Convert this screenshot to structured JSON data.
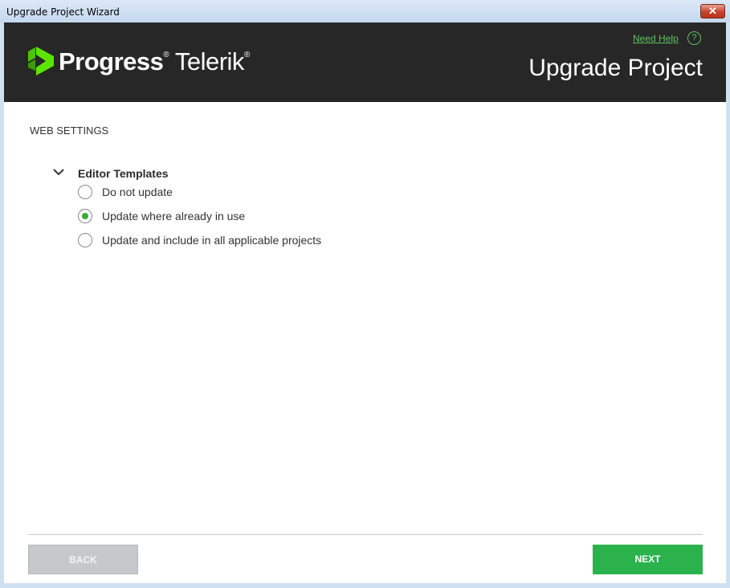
{
  "window": {
    "title": "Upgrade Project Wizard",
    "close_label": "✕"
  },
  "header": {
    "brand_primary": "Progress",
    "brand_secondary": "Telerik",
    "registered_mark": "®",
    "need_help": "Need Help",
    "help_icon": "?",
    "heading": "Upgrade Project"
  },
  "section": {
    "title": "WEB SETTINGS"
  },
  "group": {
    "title": "Editor Templates",
    "options": [
      {
        "label": "Do not update",
        "checked": false
      },
      {
        "label": "Update where already in use",
        "checked": true
      },
      {
        "label": "Update and include in all applicable projects",
        "checked": false
      }
    ]
  },
  "footer": {
    "back_label": "BACK",
    "next_label": "NEXT"
  },
  "colors": {
    "accent": "#2bb24c",
    "header_bg": "#272727",
    "logo_green": "#5ce500"
  },
  "icons": {
    "logo": "progress-logo-icon",
    "chevron": "chevron-down-icon",
    "help": "help-circle-icon"
  }
}
